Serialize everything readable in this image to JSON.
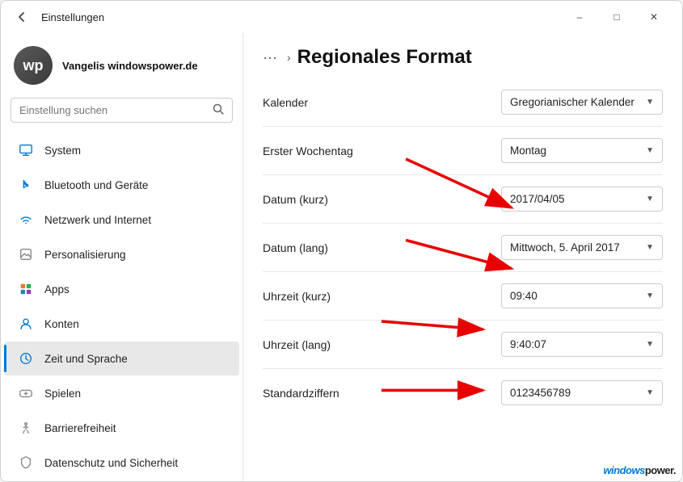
{
  "window": {
    "title": "Einstellungen",
    "minimize_label": "–",
    "maximize_label": "□",
    "close_label": "✕"
  },
  "sidebar": {
    "profile": {
      "initials": "wp",
      "name": "Vangelis windowspower.de",
      "sub_text": ""
    },
    "search_placeholder": "Einstellung suchen",
    "nav_items": [
      {
        "id": "system",
        "label": "System",
        "icon": "system"
      },
      {
        "id": "bluetooth",
        "label": "Bluetooth und Geräte",
        "icon": "bluetooth"
      },
      {
        "id": "network",
        "label": "Netzwerk und Internet",
        "icon": "network"
      },
      {
        "id": "personalization",
        "label": "Personalisierung",
        "icon": "personalization"
      },
      {
        "id": "apps",
        "label": "Apps",
        "icon": "apps"
      },
      {
        "id": "accounts",
        "label": "Konten",
        "icon": "accounts"
      },
      {
        "id": "time-language",
        "label": "Zeit und Sprache",
        "icon": "time",
        "active": true
      },
      {
        "id": "gaming",
        "label": "Spielen",
        "icon": "gaming"
      },
      {
        "id": "accessibility",
        "label": "Barrierefreiheit",
        "icon": "accessibility"
      },
      {
        "id": "privacy",
        "label": "Datenschutz und Sicherheit",
        "icon": "privacy"
      }
    ]
  },
  "panel": {
    "breadcrumb_more": "···",
    "breadcrumb_chevron": "›",
    "title": "Regionales Format",
    "rows": [
      {
        "id": "kalender",
        "label": "Kalender",
        "type": "dropdown",
        "value": "Gregorianischer Kalender"
      },
      {
        "id": "erster-wochentag",
        "label": "Erster Wochentag",
        "type": "dropdown",
        "value": "Montag"
      },
      {
        "id": "datum-kurz",
        "label": "Datum (kurz)",
        "type": "dropdown",
        "value": "2017/04/05"
      },
      {
        "id": "datum-lang",
        "label": "Datum (lang)",
        "type": "dropdown",
        "value": "Mittwoch, 5. April 2017"
      },
      {
        "id": "uhrzeit-kurz",
        "label": "Uhrzeit (kurz)",
        "type": "dropdown",
        "value": "09:40"
      },
      {
        "id": "uhrzeit-lang",
        "label": "Uhrzeit (lang)",
        "type": "dropdown",
        "value": "9:40:07"
      },
      {
        "id": "standardziffern",
        "label": "Standardziffern",
        "type": "dropdown",
        "value": "0123456789"
      }
    ]
  },
  "watermark": {
    "prefix": "windows",
    "suffix": "power."
  }
}
